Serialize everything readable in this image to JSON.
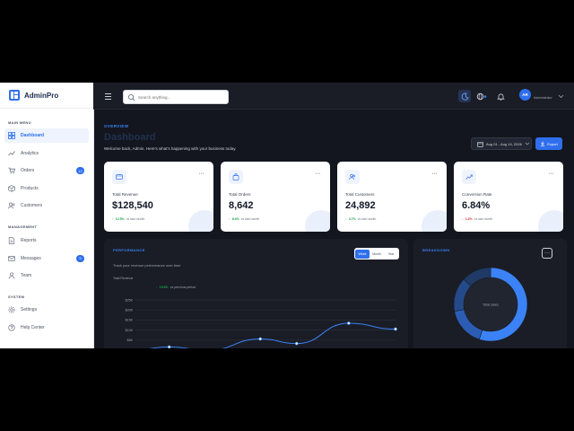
{
  "brand": {
    "name": "AdminPro",
    "color": "#2f6fed"
  },
  "sidebar": {
    "sections": [
      {
        "label": "MAIN MENU",
        "items": [
          {
            "label": "Dashboard",
            "icon": "dashboard-icon",
            "active": true
          },
          {
            "label": "Analytics",
            "icon": "analytics-icon"
          },
          {
            "label": "Orders",
            "icon": "cart-icon",
            "badge": "12"
          },
          {
            "label": "Products",
            "icon": "box-icon"
          },
          {
            "label": "Customers",
            "icon": "users-icon"
          }
        ]
      },
      {
        "label": "MANAGEMENT",
        "items": [
          {
            "label": "Reports",
            "icon": "report-icon"
          },
          {
            "label": "Messages",
            "icon": "mail-icon",
            "badge": "5"
          },
          {
            "label": "Team",
            "icon": "team-icon"
          }
        ]
      },
      {
        "label": "SYSTEM",
        "items": [
          {
            "label": "Settings",
            "icon": "gear-icon"
          },
          {
            "label": "Help Center",
            "icon": "help-icon"
          }
        ]
      }
    ]
  },
  "topbar": {
    "search_placeholder": "Search anything...",
    "avatar_initials": "AR",
    "user_role": "Administrator"
  },
  "header": {
    "eyebrow": "OVERVIEW",
    "title": "Dashboard",
    "subtitle": "Welcome back, Admin. Here's what's happening with your business today.",
    "date_range": "Aug 01 - Aug 14, 2026",
    "export_label": "Export"
  },
  "stats": [
    {
      "label": "Total Revenue",
      "value": "$128,540",
      "change": "12.5%",
      "direction": "up",
      "note": "vs last month",
      "icon": "wallet-icon"
    },
    {
      "label": "Total Orders",
      "value": "8,642",
      "change": "8.4%",
      "direction": "up",
      "note": "vs last month",
      "icon": "bag-icon"
    },
    {
      "label": "Total Customers",
      "value": "24,892",
      "change": "4.7%",
      "direction": "up",
      "note": "vs last month",
      "icon": "customers-icon"
    },
    {
      "label": "Conversion Rate",
      "value": "6.84%",
      "change": "1.2%",
      "direction": "down",
      "note": "vs last month",
      "icon": "trend-icon"
    }
  ],
  "performance": {
    "title": "PERFORMANCE",
    "subtitle": "Track your revenue performance over time",
    "total_label": "Total Revenue",
    "change": "15.6%",
    "change_note": "vs previous period",
    "periods": [
      "Week",
      "Month",
      "Year"
    ],
    "active_period": "Week"
  },
  "breakdown": {
    "title": "BREAKDOWN",
    "center_label": "Total sales"
  },
  "chart_data": {
    "type": "line",
    "y_ticks": [
      "$25K",
      "$20K",
      "$15K",
      "$10K",
      "$5K"
    ],
    "ylim": [
      0,
      25
    ],
    "points": [
      {
        "x": 0.0,
        "y": 0.3
      },
      {
        "x": 0.13,
        "y": 1.6
      },
      {
        "x": 0.28,
        "y": 0.0
      },
      {
        "x": 0.48,
        "y": 5.6
      },
      {
        "x": 0.62,
        "y": 3.3
      },
      {
        "x": 0.82,
        "y": 13.4
      },
      {
        "x": 1.0,
        "y": 10.5
      }
    ],
    "line_color": "#3b82f6",
    "grid": true
  },
  "donut_data": {
    "type": "pie",
    "slices": [
      {
        "value": 55,
        "color": "#3b82f6"
      },
      {
        "value": 17,
        "color": "#2c5db5"
      },
      {
        "value": 15,
        "color": "#254a8a"
      },
      {
        "value": 13,
        "color": "#1f3a66"
      }
    ],
    "background": "#21252f"
  }
}
